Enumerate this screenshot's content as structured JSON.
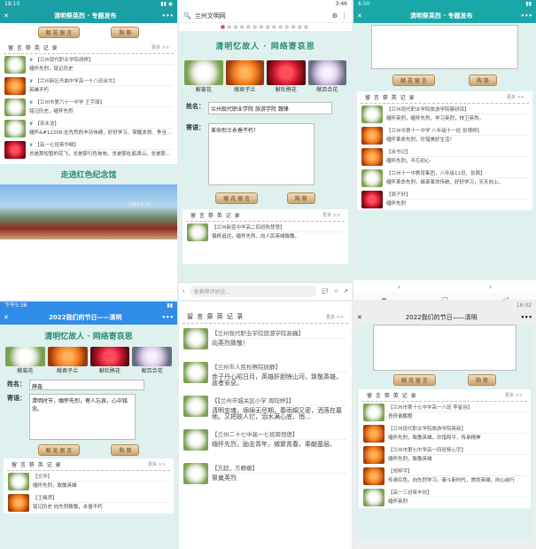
{
  "p1": {
    "status_time": "18:10",
    "header_title": "清明祭英烈 · 专题发布",
    "btn_send": "献 花 留 言",
    "btn_donate": "购 祭",
    "sec_title": "留 言 祭 英 记 录",
    "more": "更多 >>",
    "messages": [
      {
        "name": "【兰州现代职业学院胡婷】",
        "text": "缅怀先烈，铭记历史"
      },
      {
        "name": "【兰州新区舟曲中学高一十八班余文】",
        "text": "英雄不朽"
      },
      {
        "name": "【兰州市第六十一中学 王宇康】",
        "text": "铭记历史，缅怀先烈"
      },
      {
        "name": "【宋永浩】",
        "text": "缅怀&#12208;在先烈的丰功伟绩，好好学习、掌握本领、争当热爱祖国、建设&#12068..."
      },
      {
        "name": "【高一七班蒋华鳞】",
        "text": "总是那短暂的花飞，总是那行色匆匆，总是那杜鹃滴山，总是那紫嫣的……总是那紫嫣的纪..."
      }
    ],
    "banner2": "走进红色纪念馆",
    "photo_date": "1943.8.26"
  },
  "p2": {
    "url_title": "兰州文明网",
    "status_time": "3:46",
    "banner": "清明忆故人 · 网络寄哀思",
    "flowers": [
      {
        "label": "献菊花"
      },
      {
        "label": "献君子兰"
      },
      {
        "label": "献杜鹃花"
      },
      {
        "label": "献百合花"
      }
    ],
    "name_label": "姓名：",
    "name_value": "兰州现代职业学院 旅游学院 魏锋",
    "message_label": "寄语：",
    "message_value": "革命烈士永垂不朽！",
    "btn_send": "献 花 留 言",
    "btn_donate": "购 祭",
    "sec_title": "留 言 祭 英 记 录",
    "more": "更多 >>",
    "messages": [
      {
        "name": "【兰州新蓝中学高二四班陈慧慧】",
        "text": "慎终追远，缅怀先烈，向人民英雄致敬。"
      }
    ],
    "comment_placeholder": "发表神评妙论..."
  },
  "p3": {
    "status_time": "6:50",
    "header_title": "清明祭英烈 · 专题发布",
    "btn_send": "献 花 留 言",
    "btn_donate": "购 祭",
    "sec_title": "留 言 祭 英 记 录",
    "more": "更多 >>",
    "messages": [
      {
        "name": "【兰州现代职业学院旅游学院蔡研琼】",
        "text": "缅怀英烈，缅怀先烈，学习英烈，捍卫英烈。"
      },
      {
        "name": "【兰州市第十一中学 八年级十一班 张博婷】",
        "text": "缅怀革命先烈，珍惜美好生活！"
      },
      {
        "name": "【余书记】",
        "text": "缅怀先烈，不忘初心"
      },
      {
        "name": "【兰州十一中教育集团，八年级11班，张茜】",
        "text": "缅怀革命先烈，继承革命传统，好好学习，天天向上。"
      },
      {
        "name": "【周子轩】",
        "text": "缅怀先烈"
      }
    ]
  },
  "p4": {
    "status_time": "下午5:36",
    "header_title": "2022我们的节日——清明",
    "banner": "清明忆故人 · 网络寄哀思",
    "flowers": [
      {
        "label": "献菊花"
      },
      {
        "label": "献君子兰"
      },
      {
        "label": "献杜鹃花"
      },
      {
        "label": "献百合花"
      }
    ],
    "name_label": "姓名：",
    "name_value": "薛鑫",
    "message_label": "寄语：",
    "message_value": "清明时节，缅怀先烈，寄人忘哀，心中铭念。",
    "btn_send": "献 花 留 言",
    "btn_donate": "购 祭",
    "sec_title": "留 言 祭 英 记 录",
    "more": "更多 >>",
    "messages": [
      {
        "name": "【文华】",
        "text": "缅怀先烈，致敬英雄"
      },
      {
        "name": "【王曦鸢】",
        "text": "铭记历史 向先烈致敬，永垂不朽"
      }
    ]
  },
  "p5": {
    "sec_title": "留 言 祭 英 记 录",
    "more": "更多 >>",
    "messages": [
      {
        "name": "【兰州现代职业学院旅游学院高巍】",
        "text": "向英烈致敬！"
      },
      {
        "name": "【兰州市人民检察院屈静】",
        "text": "赤子丹心昭日月，英雄肝胆映山河，致敬英雄，逝者安息。"
      },
      {
        "name": "【【兰州市城关区小学 周钰婷】】",
        "text": "清明忠魂，绵绵无尽期，春雨綿又密，洒落在墓地。又把故人忆，泪水满心底，悄..."
      },
      {
        "name": "【兰州二十七中高一七班周恒德】",
        "text": "缅怀先烈，励志青年，微聚青春，奉献基层。"
      },
      {
        "name": "【方超，方静娜】",
        "text": "祭奠英烈"
      }
    ]
  },
  "p6": {
    "status_time": "16:02",
    "header_title": "2022我们的节日——清明",
    "btn_send": "献 花 留 言",
    "btn_donate": "购 祭",
    "sec_title": "留 言 祭 英 记 录",
    "more": "更多 >>",
    "messages": [
      {
        "name": "【兰州市第十七中学高一八班 李星谷】",
        "text": "吾侪奋鹏程"
      },
      {
        "name": "【兰州现代职业学院旅游学院蒋新】",
        "text": "缅怀先烈，致敬英雄，珍惜和平，传承精神"
      },
      {
        "name": "【兰州市第七中学高一四班杨心宇】",
        "text": "缅怀先烈，致敬英雄"
      },
      {
        "name": "【郑梓宇】",
        "text": "传承红色，向先烈学习，奋斗新时代，崇尚英雄，向心前行"
      },
      {
        "name": "【高一三班蒋丰欣】",
        "text": "缅怀英烈"
      }
    ]
  }
}
